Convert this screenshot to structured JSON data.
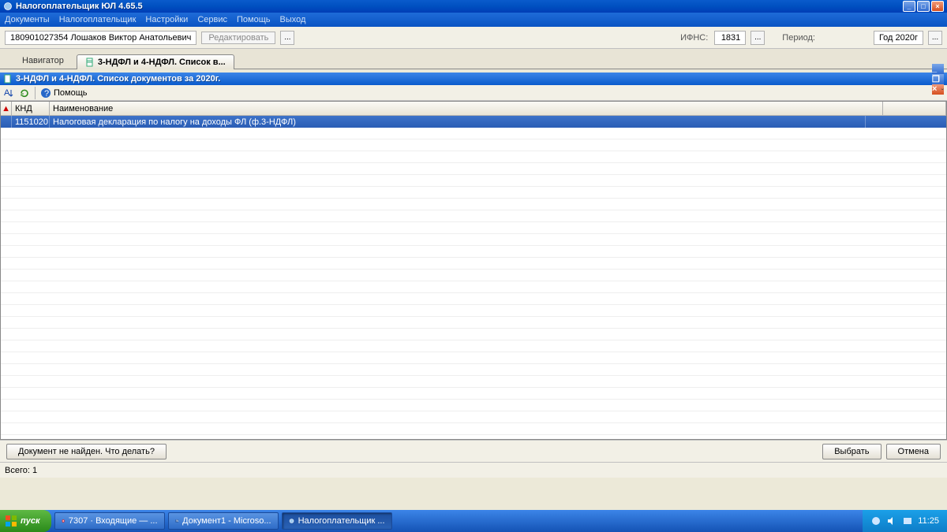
{
  "window": {
    "title": "Налогоплательщик ЮЛ 4.65.5"
  },
  "menu": {
    "items": [
      "Документы",
      "Налогоплательщик",
      "Настройки",
      "Сервис",
      "Помощь",
      "Выход"
    ]
  },
  "userbar": {
    "user": "180901027354 Лошаков Виктор Анатольевич",
    "edit": "Редактировать",
    "ifns_label": "ИФНС:",
    "ifns_value": "1831",
    "period_label": "Период:",
    "period_value": "Год 2020г"
  },
  "nav": {
    "navigator": "Навигатор",
    "tab": "3-НДФЛ и 4-НДФЛ. Список в..."
  },
  "inner": {
    "title": "3-НДФЛ и 4-НДФЛ. Список документов за 2020г."
  },
  "toolbar": {
    "help": "Помощь"
  },
  "grid": {
    "col_knd": "КНД",
    "col_name": "Наименование",
    "row": {
      "knd": "1151020",
      "name": "Налоговая декларация по налогу на доходы ФЛ (ф.3-НДФЛ)"
    }
  },
  "bottom": {
    "notfound": "Документ не найден. Что делать?",
    "select": "Выбрать",
    "cancel": "Отмена"
  },
  "status": {
    "total": "Всего: 1"
  },
  "taskbar": {
    "start": "пуск",
    "task1": "7307 · Входящие — ...",
    "task2": "Документ1 - Microso...",
    "task3": "Налогоплательщик ...",
    "clock": "11:25"
  }
}
